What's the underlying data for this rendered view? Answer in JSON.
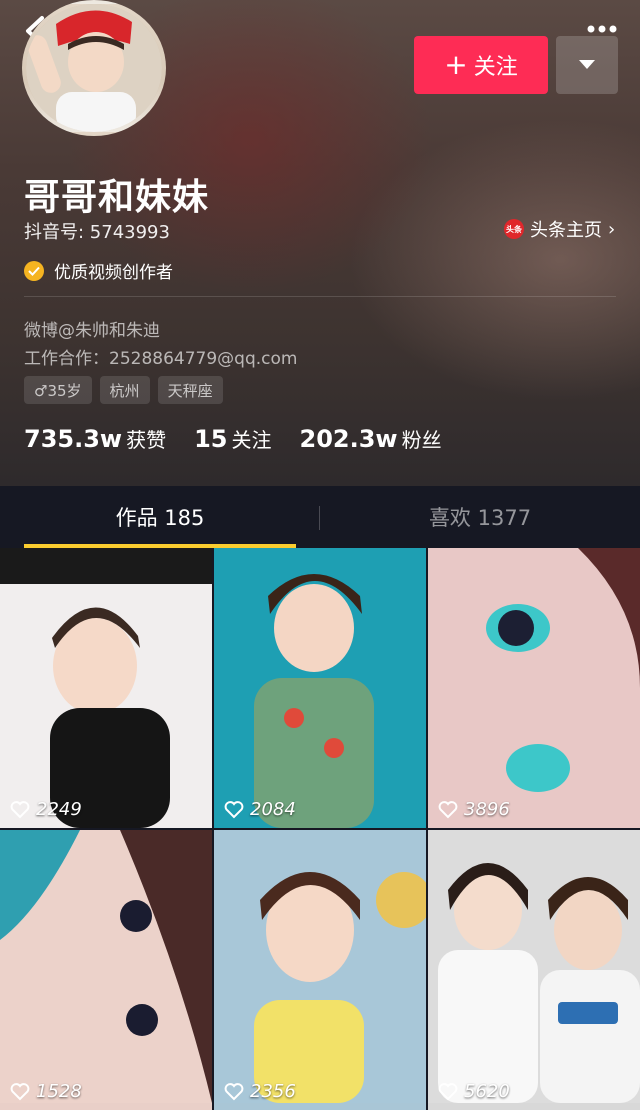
{
  "profile": {
    "nickname": "哥哥和妹妹",
    "douyin_id": "抖音号: 5743993",
    "verified_label": "优质视频创作者",
    "toutiao_icon_text": "头条",
    "toutiao_link": "头条主页",
    "bio_weibo": "微博@朱帅和朱迪",
    "bio_work": "工作合作：2528864779@qq.com",
    "tags": [
      "♂35岁",
      "杭州",
      "天秤座"
    ]
  },
  "actions": {
    "follow_plus": "+",
    "follow_label": "关注"
  },
  "stats": [
    {
      "value": "735.3w",
      "label": "获赞"
    },
    {
      "value": "15",
      "label": "关注"
    },
    {
      "value": "202.3w",
      "label": "粉丝"
    }
  ],
  "tabs": [
    {
      "label": "作品 185",
      "active": true
    },
    {
      "label": "喜欢 1377",
      "active": false
    }
  ],
  "videos": [
    {
      "likes": "2249"
    },
    {
      "likes": "2084"
    },
    {
      "likes": "3896"
    },
    {
      "likes": "1528"
    },
    {
      "likes": "2356"
    },
    {
      "likes": "5620"
    }
  ],
  "icons": [
    "back-icon",
    "more-icon",
    "avatar",
    "dropdown-icon",
    "toutiao-icon",
    "chevron-right-icon",
    "verified-icon",
    "heart-icon"
  ],
  "colors": {
    "accent": "#fe2c55",
    "tab_indicator": "#facc2f",
    "background": "#161823",
    "verified": "#f5b421"
  }
}
